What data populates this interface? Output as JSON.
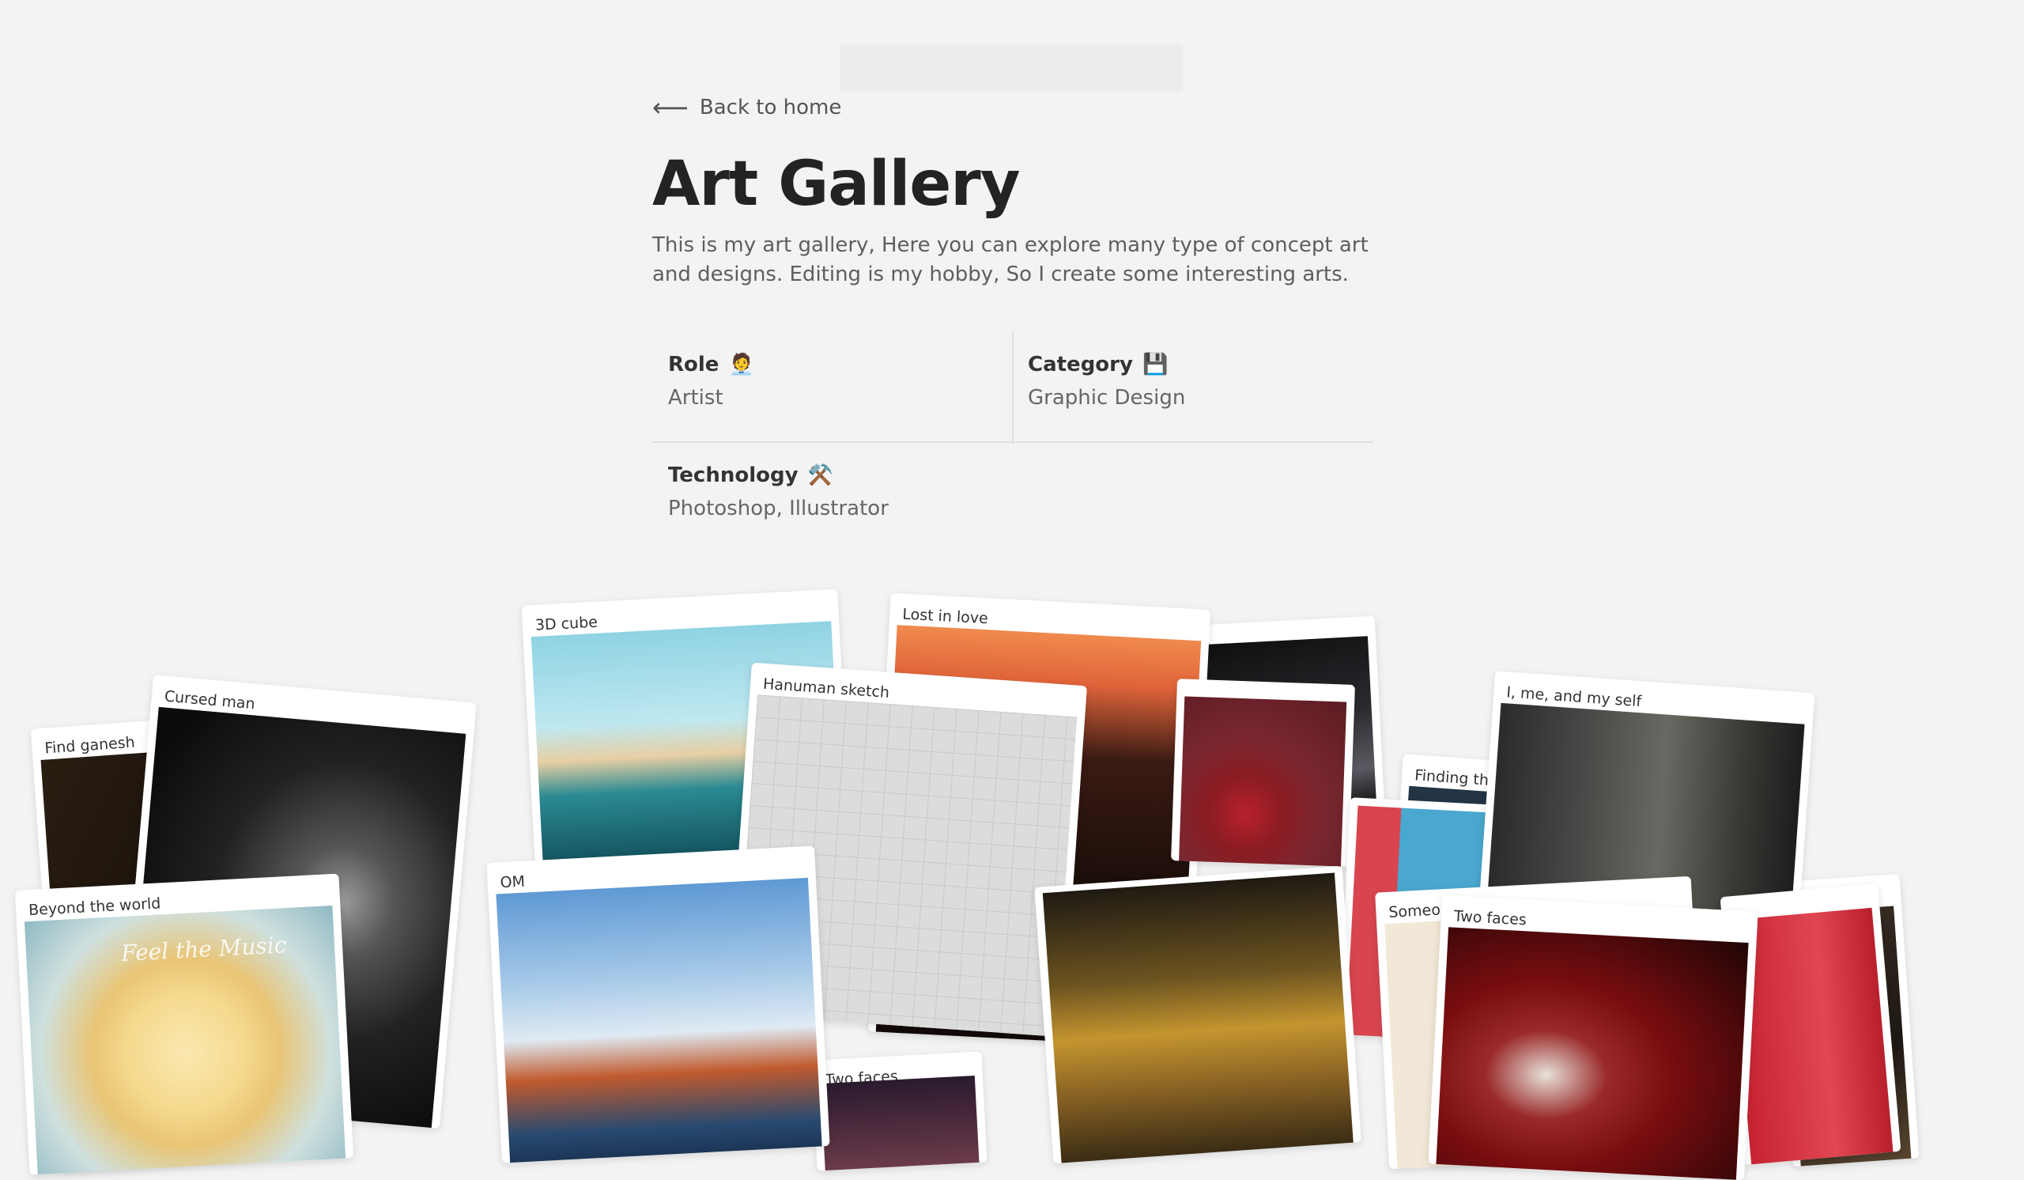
{
  "topbar": {
    "text": ""
  },
  "nav": {
    "back_label": "Back to home",
    "back_arrow": "⟵"
  },
  "page": {
    "title": "Art Gallery",
    "description": "This is my art gallery, Here you can explore many type of concept art and designs. Editing is my hobby, So I create some interesting arts."
  },
  "meta": {
    "role": {
      "label": "Role",
      "emoji": "🧑‍💼",
      "value": "Artist"
    },
    "category": {
      "label": "Category",
      "emoji": "💾",
      "value": "Graphic Design"
    },
    "technology": {
      "label": "Technology",
      "emoji": "⚒️",
      "value": "Photoshop, Illustrator"
    }
  },
  "gallery": {
    "cards": [
      {
        "title": "Find ganesh"
      },
      {
        "title": "Cursed man"
      },
      {
        "title": "3D cube"
      },
      {
        "title": "Lost in love"
      },
      {
        "title": "Hanuman sketch"
      },
      {
        "title": ""
      },
      {
        "title": ""
      },
      {
        "title": "Finding th"
      },
      {
        "title": "I, me, and my self"
      },
      {
        "title": "OM"
      },
      {
        "title": "Beyond the world"
      },
      {
        "title": "Someone"
      },
      {
        "title": "Two faces"
      },
      {
        "title": ""
      },
      {
        "title": ""
      },
      {
        "title": ""
      }
    ],
    "art_text": {
      "beyond": "Feel the Music"
    }
  }
}
